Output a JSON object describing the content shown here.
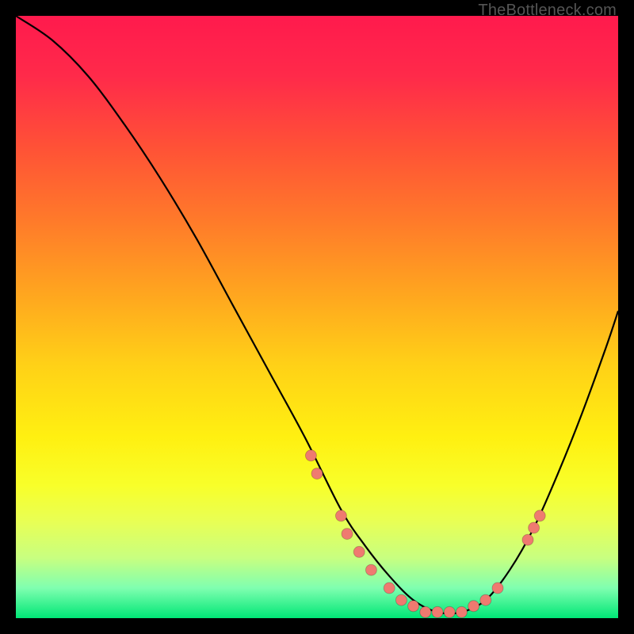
{
  "watermark": "TheBottleneck.com",
  "chart_data": {
    "type": "line",
    "title": "",
    "xlabel": "",
    "ylabel": "",
    "xlim": [
      0,
      100
    ],
    "ylim": [
      0,
      100
    ],
    "grid": false,
    "legend": false,
    "series": [
      {
        "name": "curve",
        "x": [
          0,
          6,
          12,
          18,
          24,
          30,
          36,
          42,
          48,
          54,
          58,
          62,
          66,
          70,
          74,
          78,
          82,
          86,
          90,
          94,
          98,
          100
        ],
        "y": [
          100,
          96,
          90,
          82,
          73,
          63,
          52,
          41,
          30,
          18,
          12,
          7,
          3,
          1,
          1,
          3,
          8,
          15,
          24,
          34,
          45,
          51
        ]
      }
    ],
    "points": [
      {
        "name": "p1",
        "x": 49,
        "y": 27
      },
      {
        "name": "p2",
        "x": 50,
        "y": 24
      },
      {
        "name": "p3",
        "x": 54,
        "y": 17
      },
      {
        "name": "p4",
        "x": 55,
        "y": 14
      },
      {
        "name": "p5",
        "x": 57,
        "y": 11
      },
      {
        "name": "p6",
        "x": 59,
        "y": 8
      },
      {
        "name": "p7",
        "x": 62,
        "y": 5
      },
      {
        "name": "p8",
        "x": 64,
        "y": 3
      },
      {
        "name": "p9",
        "x": 66,
        "y": 2
      },
      {
        "name": "p10",
        "x": 68,
        "y": 1
      },
      {
        "name": "p11",
        "x": 70,
        "y": 1
      },
      {
        "name": "p12",
        "x": 72,
        "y": 1
      },
      {
        "name": "p13",
        "x": 74,
        "y": 1
      },
      {
        "name": "p14",
        "x": 76,
        "y": 2
      },
      {
        "name": "p15",
        "x": 78,
        "y": 3
      },
      {
        "name": "p16",
        "x": 80,
        "y": 5
      },
      {
        "name": "p17",
        "x": 85,
        "y": 13
      },
      {
        "name": "p18",
        "x": 86,
        "y": 15
      },
      {
        "name": "p19",
        "x": 87,
        "y": 17
      }
    ],
    "point_radius_px": 7
  }
}
